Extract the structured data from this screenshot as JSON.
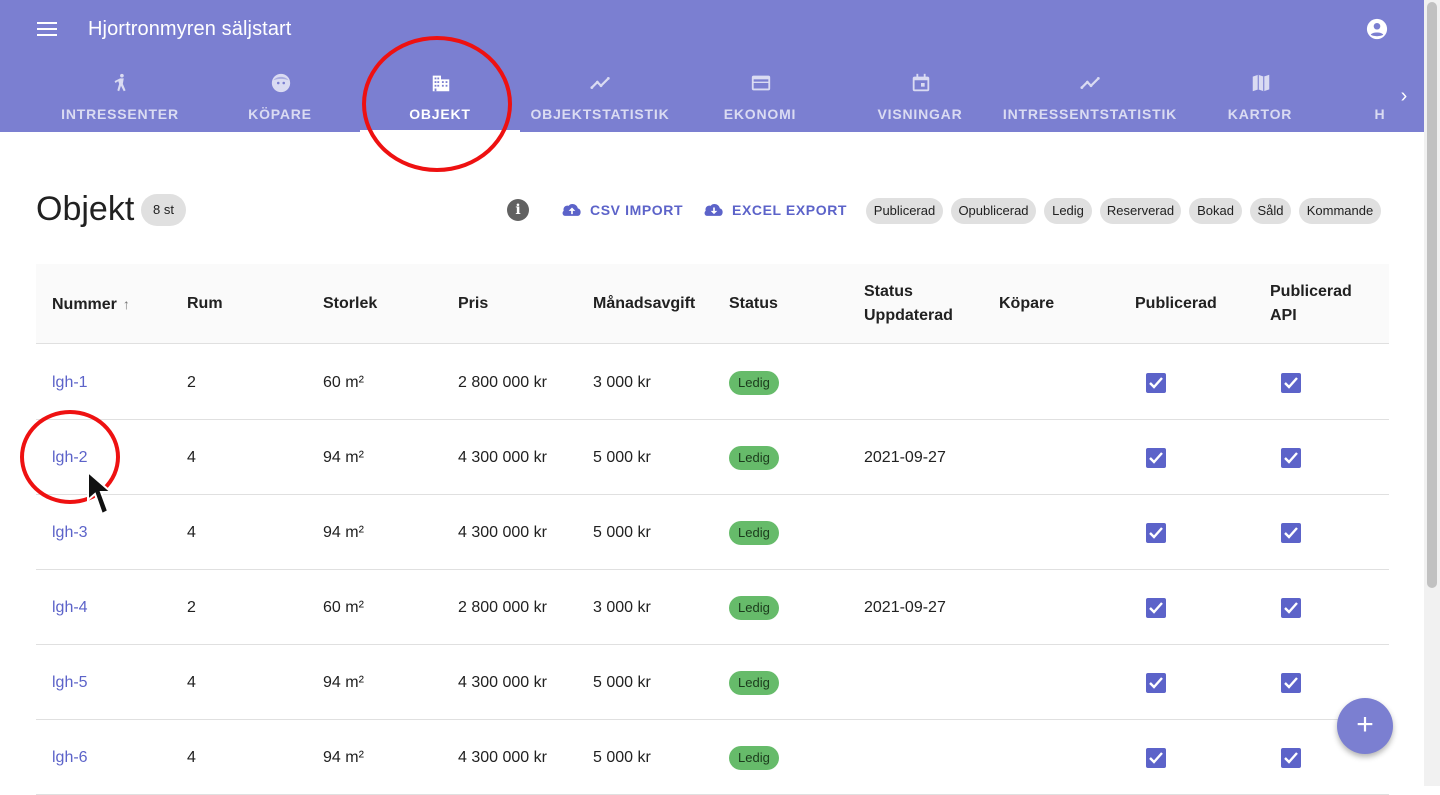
{
  "app": {
    "title": "Hjortronmyren säljstart"
  },
  "tabs": [
    {
      "label": "INTRESSENTER",
      "icon": "person-walking-icon"
    },
    {
      "label": "KÖPARE",
      "icon": "face-icon"
    },
    {
      "label": "OBJEKT",
      "icon": "building-icon",
      "active": true
    },
    {
      "label": "OBJEKTSTATISTIK",
      "icon": "trend-line-icon"
    },
    {
      "label": "EKONOMI",
      "icon": "credit-card-icon"
    },
    {
      "label": "VISNINGAR",
      "icon": "calendar-icon"
    },
    {
      "label": "INTRESSENTSTATISTIK",
      "icon": "trend-line-icon"
    },
    {
      "label": "KARTOR",
      "icon": "map-icon"
    },
    {
      "label": "H",
      "icon": ""
    }
  ],
  "page": {
    "title": "Objekt",
    "count": "8 st",
    "csv_import": "CSV IMPORT",
    "excel_export": "EXCEL EXPORT"
  },
  "filters": [
    "Publicerad",
    "Opublicerad",
    "Ledig",
    "Reserverad",
    "Bokad",
    "Såld",
    "Kommande"
  ],
  "table": {
    "headers": {
      "nummer": "Nummer",
      "rum": "Rum",
      "storlek": "Storlek",
      "pris": "Pris",
      "manadsavgift": "Månadsavgift",
      "status": "Status",
      "status_uppdaterad_1": "Status",
      "status_uppdaterad_2": "Uppdaterad",
      "kopare": "Köpare",
      "publicerad": "Publicerad",
      "publicerad_api_1": "Publicerad",
      "publicerad_api_2": "API"
    },
    "rows": [
      {
        "nummer": "lgh-1",
        "rum": "2",
        "storlek": "60 m²",
        "pris": "2 800 000 kr",
        "avgift": "3 000 kr",
        "status": "Ledig",
        "uppdaterad": "",
        "kopare": "",
        "publicerad": true,
        "api": true
      },
      {
        "nummer": "lgh-2",
        "rum": "4",
        "storlek": "94 m²",
        "pris": "4 300 000 kr",
        "avgift": "5 000 kr",
        "status": "Ledig",
        "uppdaterad": "2021-09-27",
        "kopare": "",
        "publicerad": true,
        "api": true
      },
      {
        "nummer": "lgh-3",
        "rum": "4",
        "storlek": "94 m²",
        "pris": "4 300 000 kr",
        "avgift": "5 000 kr",
        "status": "Ledig",
        "uppdaterad": "",
        "kopare": "",
        "publicerad": true,
        "api": true
      },
      {
        "nummer": "lgh-4",
        "rum": "2",
        "storlek": "60 m²",
        "pris": "2 800 000 kr",
        "avgift": "3 000 kr",
        "status": "Ledig",
        "uppdaterad": "2021-09-27",
        "kopare": "",
        "publicerad": true,
        "api": true
      },
      {
        "nummer": "lgh-5",
        "rum": "4",
        "storlek": "94 m²",
        "pris": "4 300 000 kr",
        "avgift": "5 000 kr",
        "status": "Ledig",
        "uppdaterad": "",
        "kopare": "",
        "publicerad": true,
        "api": true
      },
      {
        "nummer": "lgh-6",
        "rum": "4",
        "storlek": "94 m²",
        "pris": "4 300 000 kr",
        "avgift": "5 000 kr",
        "status": "Ledig",
        "uppdaterad": "",
        "kopare": "",
        "publicerad": true,
        "api": true
      }
    ]
  },
  "colors": {
    "primary": "#7b7fd1",
    "accent": "#5c63c9",
    "status_ledig": "#66bb6a",
    "annotation": "#ee1111"
  }
}
